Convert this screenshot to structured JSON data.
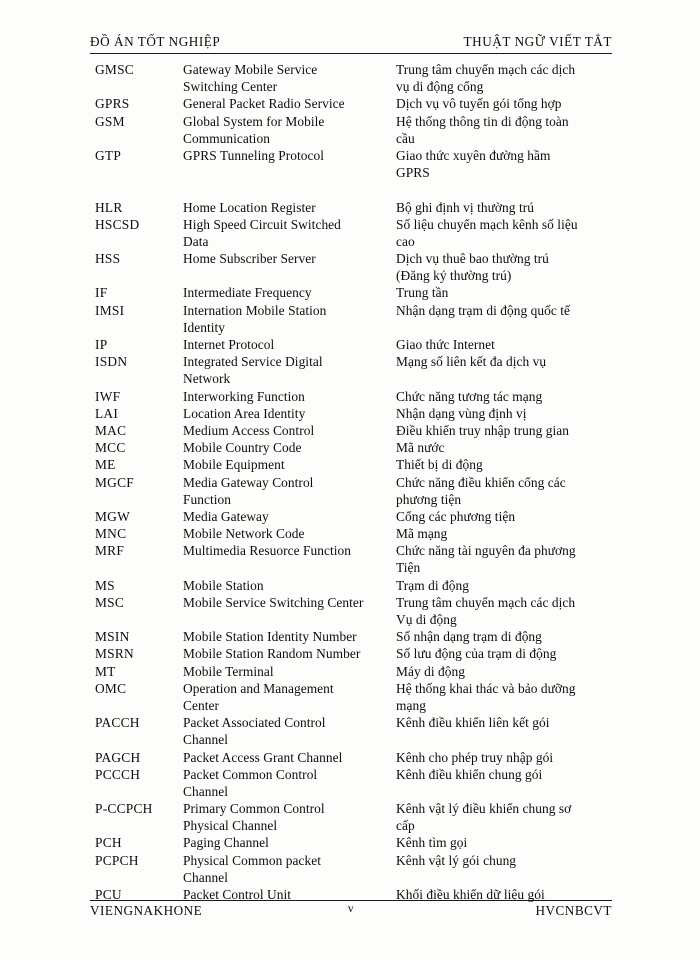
{
  "header": {
    "left": "ĐỒ ÁN TỐT NGHIỆP",
    "right": "THUẬT NGỮ VIẾT TẮT"
  },
  "footer": {
    "left": "VIENGNAKHONE",
    "page_number": "v",
    "right": "HVCNBCVT"
  },
  "columns": {
    "abbreviation": "",
    "english": "",
    "vietnamese": ""
  },
  "rows": [
    {
      "abbr": "GMSC",
      "eng": "Gateway  Mobile Service",
      "vie": "Trung tâm chuyển mạch các dịch"
    },
    {
      "abbr": "",
      "eng": "Switching  Center",
      "vie": "vụ di động cổng"
    },
    {
      "abbr": "GPRS",
      "eng": "General Packet Radio Service",
      "vie": "Dịch vụ vô tuyến gói tổng hợp"
    },
    {
      "abbr": "GSM",
      "eng": "Global System for Mobile",
      "vie": "Hệ thống thông tin di động toàn"
    },
    {
      "abbr": "",
      "eng": "Communication",
      "vie": "cầu"
    },
    {
      "abbr": "GTP",
      "eng": "GPRS Tunneling  Protocol",
      "vie": "Giao thức xuyên đường hầm"
    },
    {
      "abbr": "",
      "eng": "",
      "vie": "GPRS"
    },
    {
      "abbr": "",
      "eng": "",
      "vie": ""
    },
    {
      "abbr": "HLR",
      "eng": "Home Location Register",
      "vie": "Bộ ghi định vị thường trú"
    },
    {
      "abbr": "HSCSD",
      "eng": "High Speed Circuit Switched",
      "vie": "Số liệu chuyển mạch kênh số liệu"
    },
    {
      "abbr": "",
      "eng": "Data",
      "vie": "cao"
    },
    {
      "abbr": "HSS",
      "eng": "Home Subscriber Server",
      "vie": "Dịch vụ thuê bao thường trú"
    },
    {
      "abbr": "",
      "eng": "",
      "vie": "(Đăng ký thường trú)"
    },
    {
      "abbr": "IF",
      "eng": "Intermediate Frequency",
      "vie": "Trung tần"
    },
    {
      "abbr": "IMSI",
      "eng": "Internation Mobile Station",
      "vie": "Nhận dạng trạm di động quốc tế"
    },
    {
      "abbr": "",
      "eng": "Identity",
      "vie": ""
    },
    {
      "abbr": "IP",
      "eng": "Internet Protocol",
      "vie": "Giao thức Internet"
    },
    {
      "abbr": "ISDN",
      "eng": "Integrated Service Digital",
      "vie": "Mạng số liên kết đa dịch vụ"
    },
    {
      "abbr": "",
      "eng": "Network",
      "vie": ""
    },
    {
      "abbr": "IWF",
      "eng": "Interworking  Function",
      "vie": "Chức năng tương tác mạng"
    },
    {
      "abbr": "LAI",
      "eng": "Location Area Identity",
      "vie": "Nhận dạng vùng định vị"
    },
    {
      "abbr": "MAC",
      "eng": "Medium Access Control",
      "vie": "Điều khiển truy nhập trung gian"
    },
    {
      "abbr": "MCC",
      "eng": "Mobile Country  Code",
      "vie": "Mã nước"
    },
    {
      "abbr": "ME",
      "eng": "Mobile Equipment",
      "vie": "Thiết bị di động"
    },
    {
      "abbr": "MGCF",
      "eng": "Media Gateway  Control",
      "vie": "Chức năng điều khiển cổng các"
    },
    {
      "abbr": "",
      "eng": "Function",
      "vie": "phương tiện"
    },
    {
      "abbr": "MGW",
      "eng": "Media Gateway",
      "vie": "Cổng các phương tiện"
    },
    {
      "abbr": "MNC",
      "eng": "Mobile Network  Code",
      "vie": "Mã mạng"
    },
    {
      "abbr": "MRF",
      "eng": "Multimedia  Resuorce Function",
      "vie": "Chức năng tài nguyên đa phương"
    },
    {
      "abbr": "",
      "eng": "",
      "vie": "Tiện"
    },
    {
      "abbr": "MS",
      "eng": "Mobile Station",
      "vie": "Trạm di động"
    },
    {
      "abbr": "MSC",
      "eng": "Mobile Service Switching  Center",
      "vie": "Trung tâm chuyển mạch các dịch"
    },
    {
      "abbr": "",
      "eng": "",
      "vie": "Vụ di động"
    },
    {
      "abbr": "MSIN",
      "eng": "Mobile Station Identity Number",
      "vie": "Số nhận dạng trạm di động"
    },
    {
      "abbr": "MSRN",
      "eng": "Mobile Station Random  Number",
      "vie": "Số lưu động của trạm di động"
    },
    {
      "abbr": "MT",
      "eng": "Mobile Terminal",
      "vie": "Máy di động"
    },
    {
      "abbr": "OMC",
      "eng": "Operation and Management",
      "vie": "Hệ thống khai thác và bảo dưỡng"
    },
    {
      "abbr": "",
      "eng": "Center",
      "vie": "mạng"
    },
    {
      "abbr": "PACCH",
      "eng": "Packet Associated Control",
      "vie": "Kênh điều khiển liên kết gói"
    },
    {
      "abbr": "",
      "eng": "Channel",
      "vie": ""
    },
    {
      "abbr": "PAGCH",
      "eng": "Packet Access Grant Channel",
      "vie": "Kênh cho phép truy nhập gói"
    },
    {
      "abbr": "PCCCH",
      "eng": "Packet Common Control",
      "vie": "Kênh điều khiển chung gói"
    },
    {
      "abbr": "",
      "eng": "Channel",
      "vie": ""
    },
    {
      "abbr": "P-CCPCH",
      "eng": "Primary Common Control",
      "vie": "Kênh vật lý điều khiển chung sơ"
    },
    {
      "abbr": "",
      "eng": "Physical Channel",
      "vie": "cấp"
    },
    {
      "abbr": "PCH",
      "eng": "Paging  Channel",
      "vie": "Kênh tìm gọi"
    },
    {
      "abbr": "PCPCH",
      "eng": "Physical Common packet",
      "vie": "Kênh vật lý gói chung"
    },
    {
      "abbr": "",
      "eng": "Channel",
      "vie": ""
    },
    {
      "abbr": "PCU",
      "eng": "Packet Control Unit",
      "vie": "Khối điều khiển dữ liệu gói"
    }
  ]
}
